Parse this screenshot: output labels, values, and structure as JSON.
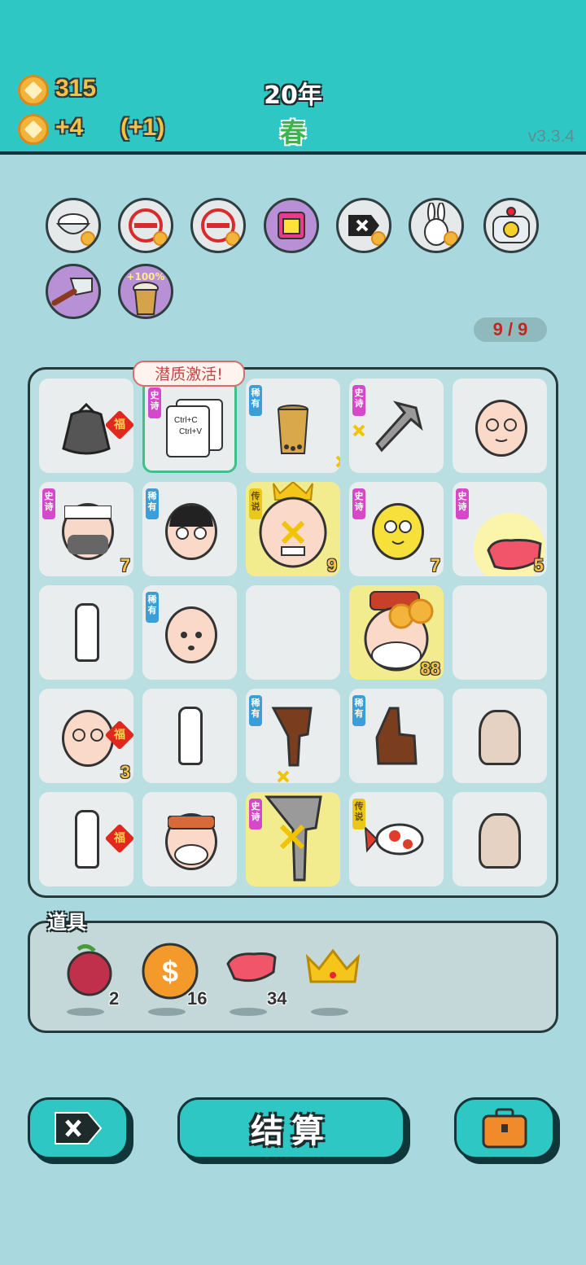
{
  "header": {
    "coins": "315",
    "income": "+4",
    "income_bonus": "(+1)",
    "year": "20年",
    "season": "春",
    "version": "v3.3.4"
  },
  "relics": [
    {
      "icon": "rice-bowl-icon"
    },
    {
      "icon": "no-entry-icon"
    },
    {
      "icon": "no-entry-icon"
    },
    {
      "icon": "gift-box-icon"
    },
    {
      "icon": "remove-tag-icon"
    },
    {
      "icon": "rabbit-icon"
    },
    {
      "icon": "duck-pot-icon"
    },
    {
      "icon": "cleaver-icon"
    },
    {
      "icon": "bubble-tea-icon",
      "badge": "+100%"
    }
  ],
  "counter": "9 / 9",
  "tooltip": "潜质激活!",
  "rarity": {
    "epic": "史诗",
    "rare": "稀有",
    "legend": "传说",
    "fu": "福"
  },
  "board": [
    {
      "name": "trash-bag",
      "fu": true
    },
    {
      "name": "copy-paste-card",
      "tag": "epic",
      "text1": "Ctrl+C",
      "text2": "Ctrl+V"
    },
    {
      "name": "bubble-tea-cup",
      "tag": "rare"
    },
    {
      "name": "pointing-hand-grey",
      "tag": "epic"
    },
    {
      "name": "old-man-glasses"
    },
    {
      "name": "bearded-chef",
      "tag": "epic",
      "num": "7"
    },
    {
      "name": "boy-with-glasses",
      "tag": "rare"
    },
    {
      "name": "king-old-man",
      "tag": "legend",
      "num": "9"
    },
    {
      "name": "yellow-chick-face",
      "tag": "epic",
      "num": "7"
    },
    {
      "name": "glowing-old-man",
      "tag": "epic",
      "num": "5"
    },
    {
      "name": "milk-bottle"
    },
    {
      "name": "bald-man",
      "tag": "rare"
    },
    {
      "name": "empty"
    },
    {
      "name": "santa-with-coins",
      "num": "88"
    },
    {
      "name": "empty"
    },
    {
      "name": "old-man-glasses",
      "fu": true,
      "num": "3"
    },
    {
      "name": "milk-bottle"
    },
    {
      "name": "pointing-hand-brown-down",
      "tag": "rare"
    },
    {
      "name": "pointing-hand-brown-up",
      "tag": "rare"
    },
    {
      "name": "mouse"
    },
    {
      "name": "milk-bottle",
      "fu": true
    },
    {
      "name": "bearded-man-cap"
    },
    {
      "name": "pointing-hand-grey-down",
      "tag": "epic"
    },
    {
      "name": "koi-fish",
      "tag": "legend"
    },
    {
      "name": "mouse"
    }
  ],
  "tools": {
    "title": "道具",
    "items": [
      {
        "icon": "lychee-icon",
        "count": "2"
      },
      {
        "icon": "dollar-coin-icon",
        "count": "16"
      },
      {
        "icon": "liver-icon",
        "count": "34"
      },
      {
        "icon": "crown-icon",
        "count": ""
      }
    ]
  },
  "buttons": {
    "settle": "结算"
  },
  "colors": {
    "background": "#a9d9df",
    "topbar": "#2fc7c4",
    "coin": "#f2b43a",
    "epic": "#d448c9",
    "rare": "#3b9ed6",
    "legend": "#e8c81a"
  }
}
